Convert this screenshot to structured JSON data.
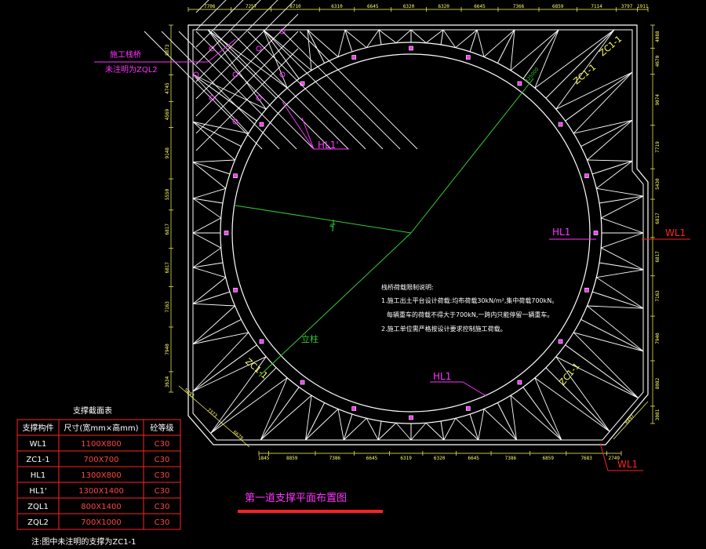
{
  "drawing": {
    "title": "第一道支撑平面布置图",
    "colors": {
      "background": "#000000",
      "structure": "#ffffff",
      "dimension": "#ffff66",
      "leader": "#ff33ff",
      "wl_leader": "#ff2222",
      "axis": "#33cc33",
      "table_border": "#ff2222",
      "title": "#ff33ff",
      "title_bar": "#ff2222"
    }
  },
  "dimensions": {
    "top": [
      "7706",
      "7257",
      "8710",
      "6310",
      "6645",
      "6320",
      "6320",
      "6645",
      "7366",
      "6859",
      "7114",
      "3797",
      "1911"
    ],
    "bottom": [
      "1845",
      "8859",
      "7386",
      "6645",
      "6319",
      "6320",
      "6645",
      "7386",
      "6859",
      "7683",
      "2749"
    ],
    "left": [
      "8873",
      "4745",
      "4569",
      "9148",
      "5550",
      "6817",
      "6817",
      "7163",
      "7940",
      "3634"
    ],
    "right": [
      "4088",
      "4670",
      "9074",
      "7719",
      "5430",
      "6817",
      "6817",
      "7163",
      "7940",
      "8082",
      "3081"
    ],
    "bottom_left_diag": [
      "5093",
      "7373",
      "6679"
    ],
    "bottom_right_diag": [
      "8497"
    ]
  },
  "labels": {
    "trestle_line1": "施工栈桥",
    "trestle_line2": "未注明为ZQL2",
    "hl1_prime": "HL1'",
    "zc1_top_right": "ZC1-1",
    "zc1_right": "ZC1-1",
    "zc1_left": "ZC1-1",
    "zc1_bottom_right": "ZC1-1",
    "hl1_right": "HL1",
    "wl1_right": "WL1",
    "column": "立柱",
    "hl1_bottom": "HL1",
    "wl1_bottom": "WL1",
    "angle": "4°",
    "radius": "R25000"
  },
  "notes": {
    "title": "栈桥荷载限制说明:",
    "line1": "1.施工出土平台设计荷载:均布荷载30kN/m²,集中荷载700kN。",
    "line2": "每辆重车的荷载不得大于700kN,一跨内只能停留一辆重车。",
    "line3": "2.施工单位需严格按设计要求控制施工荷载。"
  },
  "table": {
    "title": "支撑截面表",
    "headers": [
      "支撑构件",
      "尺寸(宽mm×高mm)",
      "砼等级"
    ],
    "rows": [
      [
        "WL1",
        "1100X800",
        "C30"
      ],
      [
        "ZC1-1",
        "700X700",
        "C30"
      ],
      [
        "HL1",
        "1300X800",
        "C30"
      ],
      [
        "HL1'",
        "1300X1400",
        "C30"
      ],
      [
        "ZQL1",
        "800X1400",
        "C30"
      ],
      [
        "ZQL2",
        "700X1000",
        "C30"
      ]
    ],
    "note": "注:图中未注明的支撑为ZC1-1"
  }
}
